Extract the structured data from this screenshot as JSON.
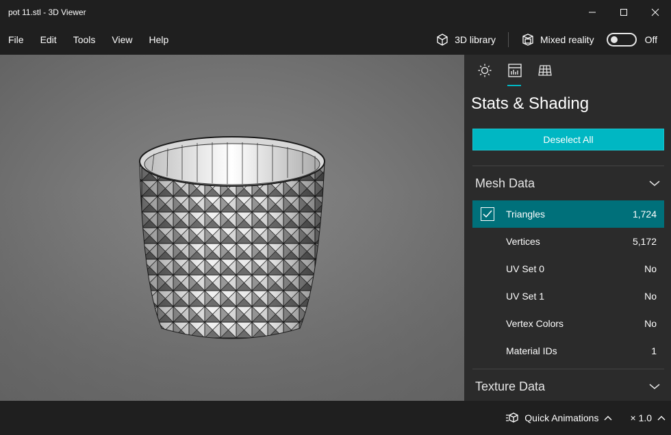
{
  "window": {
    "title": "pot 11.stl - 3D Viewer"
  },
  "menu": {
    "file": "File",
    "edit": "Edit",
    "tools": "Tools",
    "view": "View",
    "help": "Help"
  },
  "toolbar": {
    "library_label": "3D library",
    "mixed_reality_label": "Mixed reality",
    "toggle_state": "Off"
  },
  "panel": {
    "tabs": [
      {
        "icon": "sun-icon"
      },
      {
        "icon": "stats-icon",
        "active": true
      },
      {
        "icon": "grid-icon"
      }
    ],
    "title": "Stats & Shading",
    "deselect_label": "Deselect All",
    "mesh_section": "Mesh Data",
    "rows": [
      {
        "label": "Triangles",
        "value": "1,724",
        "selected": true,
        "checked": true
      },
      {
        "label": "Vertices",
        "value": "5,172"
      },
      {
        "label": "UV Set 0",
        "value": "No"
      },
      {
        "label": "UV Set 1",
        "value": "No"
      },
      {
        "label": "Vertex Colors",
        "value": "No"
      },
      {
        "label": "Material IDs",
        "value": "1"
      }
    ],
    "texture_section": "Texture Data"
  },
  "status": {
    "animations_label": "Quick Animations",
    "zoom_label": "× 1.0"
  },
  "colors": {
    "accent": "#00b7c3",
    "selected_row": "#00707a",
    "panel_bg": "#2b2b2b",
    "chrome_bg": "#1f1f1f"
  }
}
